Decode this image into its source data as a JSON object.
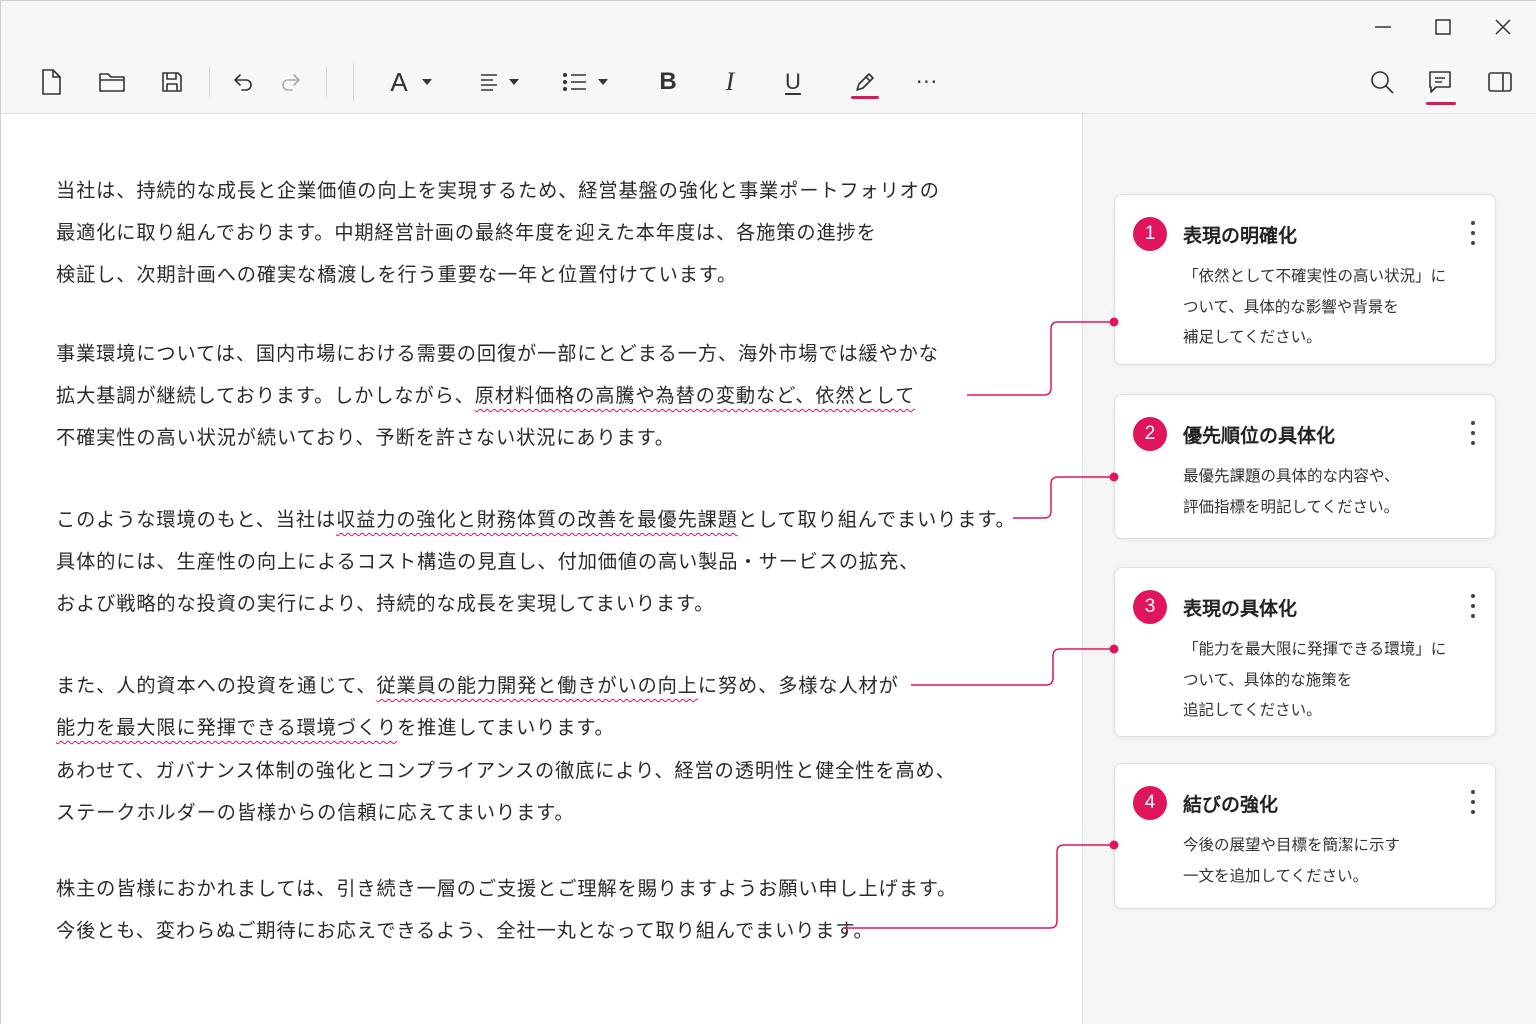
{
  "toolbar": {
    "font_label": "A",
    "bold_label": "B",
    "italic_label": "I",
    "underline_label": "U",
    "more_label": "···",
    "accent_color": "#e0155e"
  },
  "document": {
    "lines": [
      "当社は、持続的な成長と企業価値の向上を実現するため、経営基盤の強化と事業ポートフォリオの",
      "最適化に取り組んでおります。中期経営計画の最終年度を迎えた本年度は、各施策の進捗を",
      "検証し、次期計画への確実な橋渡しを行う重要な一年と位置付けています。",
      "事業環境については、国内市場における需要の回復が一部にとどまる一方、海外市場では緩やかな",
      "拡大基調が継続しております。しかしながら、",
      "原材料価格の高騰や為替の変動など、依然として",
      "不確実性の高い状況が続いており、予断を許さない状況にあります。",
      "このような環境のもと、当社は",
      "収益力の強化と財務体質の改善を最優先課題",
      "として取り組んでまいります。",
      "具体的には、生産性の向上によるコスト構造の見直し、付加価値の高い製品・サービスの拡充、",
      "および戦略的な投資の実行により、持続的な成長を実現してまいります。",
      "また、人的資本への投資を通じて、",
      "従業員の能力開発と働きがいの向上",
      "に努め、多様な人材が",
      "能力を最大限に発揮できる環境づくり",
      "を推進してまいります。",
      "あわせて、ガバナンス体制の強化とコンプライアンスの徹底により、経営の透明性と健全性を高め、",
      "ステークホルダーの皆様からの信頼に応えてまいります。",
      "株主の皆様におかれましては、引き続き一層のご支援とご理解を賜りますようお願い申し上げます。",
      "今後とも、変わらぬご期待にお応えできるよう、全社一丸となって取り組んでまいります。"
    ]
  },
  "comments": [
    {
      "number": "1",
      "title": "表現の明確化",
      "body": [
        "「依然として不確実性の高い状況」に",
        "ついて、具体的な影響や背景を",
        "補足してください。"
      ]
    },
    {
      "number": "2",
      "title": "優先順位の具体化",
      "body": [
        "最優先課題の具体的な内容や、",
        "評価指標を明記してください。"
      ]
    },
    {
      "number": "3",
      "title": "表現の具体化",
      "body": [
        "「能力を最大限に発揮できる環境」に",
        "ついて、具体的な施策を",
        "追記してください。"
      ]
    },
    {
      "number": "4",
      "title": "結びの強化",
      "body": [
        "今後の展望や目標を簡潔に示す",
        "一文を追加してください。"
      ]
    }
  ]
}
